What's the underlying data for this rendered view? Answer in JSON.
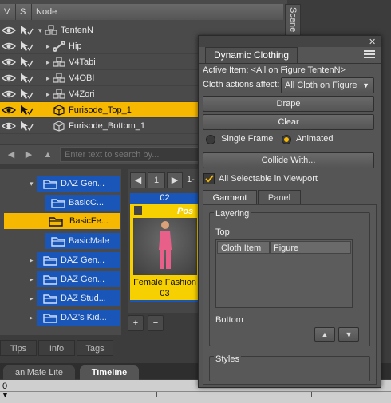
{
  "scene": {
    "columns": [
      "V",
      "S",
      "Node"
    ],
    "side_tab": "Scene",
    "rows": [
      {
        "label": "TentenN",
        "indent": 0,
        "expander": "▾",
        "icon": "figure-icon",
        "selected": false
      },
      {
        "label": "Hip",
        "indent": 1,
        "expander": "▸",
        "icon": "bone-icon",
        "selected": false
      },
      {
        "label": "V4Tabi",
        "indent": 1,
        "expander": "▸",
        "icon": "figure-icon",
        "selected": false
      },
      {
        "label": "V4OBI",
        "indent": 1,
        "expander": "▸",
        "icon": "figure-icon",
        "selected": false
      },
      {
        "label": "V4Zori",
        "indent": 1,
        "expander": "▸",
        "icon": "figure-icon",
        "selected": false
      },
      {
        "label": "Furisode_Top_1",
        "indent": 1,
        "expander": "",
        "icon": "cube-icon",
        "selected": true
      },
      {
        "label": "Furisode_Bottom_1",
        "indent": 1,
        "expander": "",
        "icon": "cube-icon",
        "selected": false
      }
    ]
  },
  "library": {
    "search_placeholder": "Enter text to search by...",
    "tree": [
      {
        "label": "DAZ Gen...",
        "selected": false
      },
      {
        "label": "BasicC...",
        "selected": false
      },
      {
        "label": "BasicFe...",
        "selected": true
      },
      {
        "label": "BasicMale",
        "selected": false
      },
      {
        "label": "DAZ Gen...",
        "selected": false
      },
      {
        "label": "DAZ Gen...",
        "selected": false
      },
      {
        "label": "DAZ Stud...",
        "selected": false
      },
      {
        "label": "DAZ's Kid...",
        "selected": false
      }
    ],
    "page": "1",
    "page_suffix": "1-",
    "tile_top_num": "02",
    "tile_badge": "Pos",
    "tile_label": "Female Fashion",
    "tile_num": "03",
    "add_label": "+",
    "remove_label": "−",
    "footer_tabs": [
      "Tips",
      "Info",
      "Tags"
    ]
  },
  "timeline": {
    "tabs": [
      "aniMate Lite",
      "Timeline"
    ],
    "active_tab": "Timeline",
    "start": "0"
  },
  "dynamic_clothing": {
    "title": "Dynamic Clothing",
    "close_glyph": "✕",
    "active_item": "Active Item: <All on Figure TentenN>",
    "affect_label": "Cloth actions affect:",
    "affect_value": "All Cloth on Figure",
    "drape_label": "Drape",
    "clear_label": "Clear",
    "single_frame_label": "Single Frame",
    "animated_label": "Animated",
    "animated_selected": true,
    "collide_label": "Collide With...",
    "all_selectable_label": "All Selectable in Viewport",
    "all_selectable_checked": true,
    "subtabs": [
      "Garment",
      "Panel"
    ],
    "active_subtab": "Garment",
    "layering_label": "Layering",
    "top_label": "Top",
    "table_headers": [
      "Cloth Item",
      "Figure"
    ],
    "bottom_label": "Bottom",
    "styles_label": "Styles"
  }
}
